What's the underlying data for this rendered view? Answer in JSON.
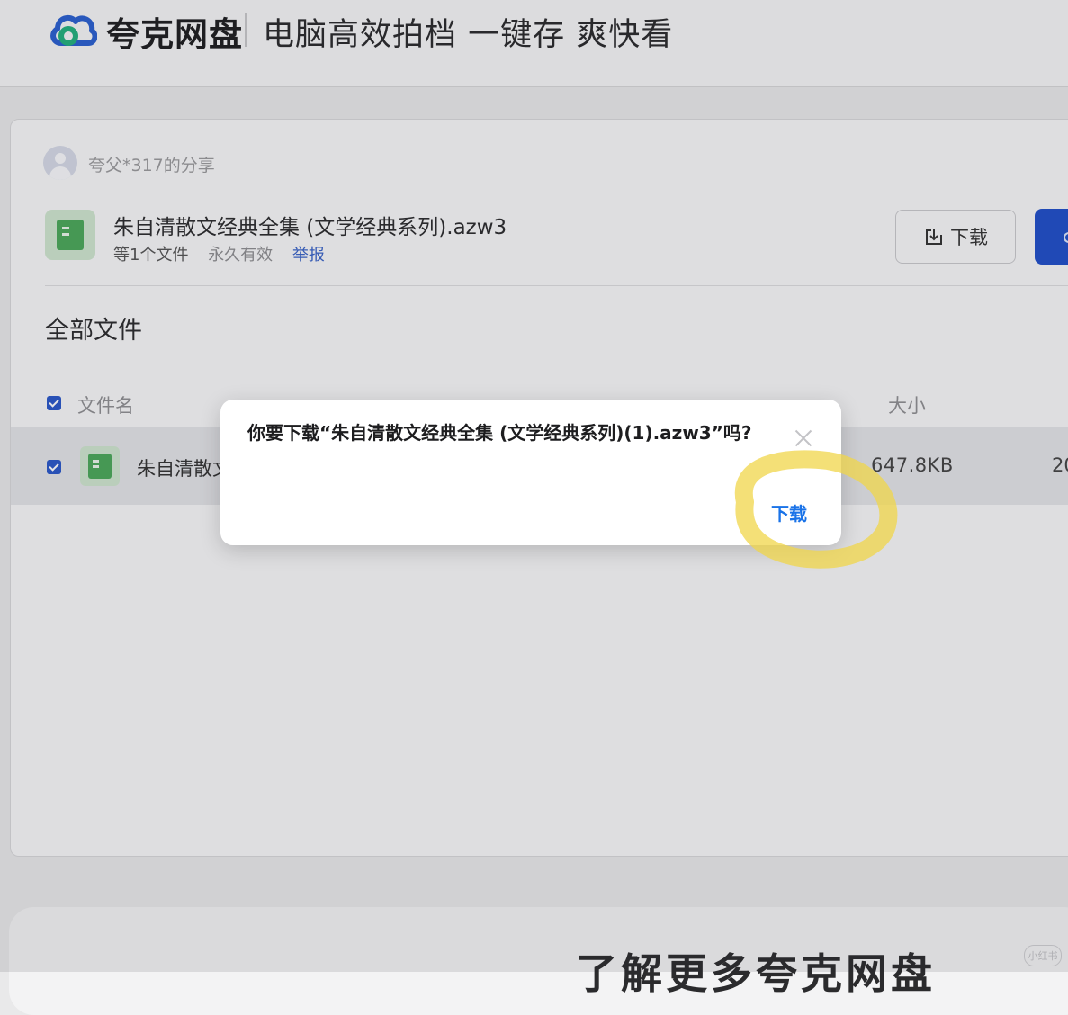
{
  "header": {
    "brand": "夸克网盘",
    "slogan": "电脑高效拍档 一键存 爽快看"
  },
  "share": {
    "sharer": "夸父*317的分享",
    "file_title": "朱自清散文经典全集 (文学经典系列).azw3",
    "file_count": "等1个文件",
    "validity": "永久有效",
    "report_label": "举报",
    "download_label": "下载"
  },
  "files": {
    "section_title": "全部文件",
    "columns": {
      "name": "文件名",
      "size": "大小",
      "date_partial": "20"
    },
    "rows": [
      {
        "name": "朱自清散文",
        "size": "647.8KB"
      }
    ]
  },
  "dialog": {
    "message": "你要下载“朱自清散文经典全集 (文学经典系列)(1).azw3”吗?",
    "download_label": "下载"
  },
  "bottom": {
    "heading": "了解更多夸克网盘",
    "watermark": "小红书"
  },
  "colors": {
    "accent": "#1f4ec9",
    "link": "#3a63c8",
    "dialog_action": "#1a73e8",
    "file_green": "#4aa859",
    "highlight": "#f0d64a"
  }
}
